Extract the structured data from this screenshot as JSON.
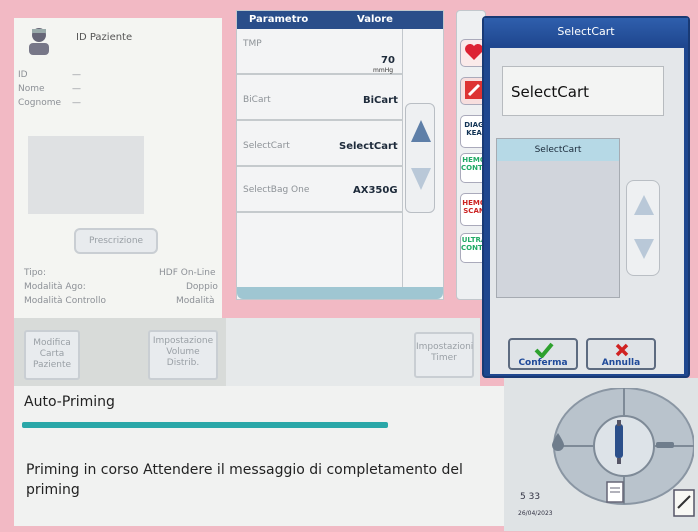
{
  "patient": {
    "title": "ID Paziente",
    "id_label": "ID",
    "name_label": "Nome",
    "surname_label": "Cognome",
    "id_value": "—",
    "name_value": "—",
    "surname_value": "—",
    "prescription_button": "Prescrizione",
    "tipo_label": "Tipo:",
    "tipo_value": "HDF On-Line",
    "ago_label": "Modalità Ago:",
    "ago_value": "Doppio",
    "controllo_label": "Modalità Controllo",
    "controllo_value": "Modalità"
  },
  "cards": {
    "modifica": "Modifica Carta Paziente",
    "impostazione_volume": "Impostazione Volume Distrib.",
    "impostazioni_timer": "Impostazioni Timer"
  },
  "table": {
    "header_param": "Parametro",
    "header_value": "Valore",
    "rows": [
      {
        "name": "TMP",
        "value": "70",
        "unit": "mmHg"
      },
      {
        "name": "BiCart",
        "value": "BiCart"
      },
      {
        "name": "SelectCart",
        "value": "SelectCart"
      },
      {
        "name": "SelectBag One",
        "value": "AX350G"
      }
    ]
  },
  "icons": {
    "diag": "DIAG KEA",
    "hemo_control": "HEMO CONTROL",
    "hemo_scan": "HEMO SCAN",
    "ultra_control": "ULTRA CONTROL"
  },
  "dialog": {
    "title": "SelectCart",
    "selected_value": "SelectCart",
    "list_items": [
      "SelectCart"
    ],
    "confirm_label": "Conferma",
    "cancel_label": "Annulla"
  },
  "status": {
    "title": "Auto-Priming",
    "message": "Priming in corso  Attendere il messaggio di completamento del priming",
    "time": "5 33",
    "date": "26/04/2023"
  },
  "colors": {
    "accent": "#1f478f",
    "progress": "#2aa7a8",
    "confirm_check": "#2ea12e",
    "cancel_x": "#d02222"
  }
}
